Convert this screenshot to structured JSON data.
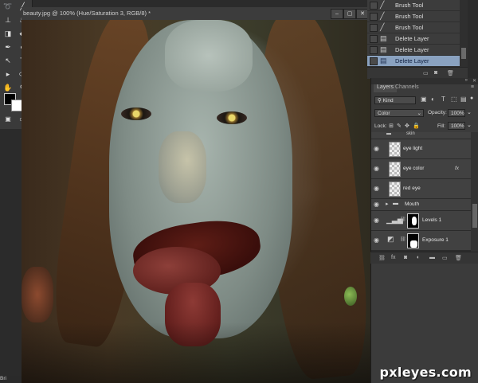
{
  "document": {
    "tab_title": "beauty.jpg @ 100% (Hue/Saturation 3, RGB/8) *",
    "status_text": "Bri"
  },
  "toolbar": {
    "icons": [
      "lasso-icon",
      "brush-icon",
      "stamp-icon",
      "bucket-icon",
      "pen-icon",
      "text-icon",
      "selection-icon",
      "ellipse-icon",
      "hand-icon",
      "zoom-icon"
    ]
  },
  "history": {
    "items": [
      {
        "label": "Brush Tool",
        "icon": "brush-icon",
        "selected": false
      },
      {
        "label": "Brush Tool",
        "icon": "brush-icon",
        "selected": false
      },
      {
        "label": "Brush Tool",
        "icon": "brush-icon",
        "selected": false
      },
      {
        "label": "Delete Layer",
        "icon": "layer-icon",
        "selected": false
      },
      {
        "label": "Delete Layer",
        "icon": "layer-icon",
        "selected": false
      },
      {
        "label": "Delete Layer",
        "icon": "layer-icon",
        "selected": true
      }
    ]
  },
  "layers_panel": {
    "tabs": [
      "Layers",
      "Channels"
    ],
    "kind_label": "Kind",
    "blend_mode": "Color",
    "opacity_label": "Opacity:",
    "opacity_value": "100%",
    "lock_label": "Lock:",
    "fill_label": "Fill:",
    "fill_value": "100%",
    "group_skin": "skin",
    "layers": [
      {
        "name": "eye light",
        "type": "pixel",
        "fx": ""
      },
      {
        "name": "eye color",
        "type": "pixel",
        "fx": "fx"
      },
      {
        "name": "red eye",
        "type": "pixel",
        "fx": ""
      }
    ],
    "group_mouth": "Mouth",
    "adjustments": [
      {
        "name": "Levels 1"
      },
      {
        "name": "Exposure 1"
      }
    ]
  },
  "watermark": "pxleyes.com",
  "colors": {
    "panel_bg": "#3b3b3b",
    "selection_blue": "#8aa2c0"
  }
}
